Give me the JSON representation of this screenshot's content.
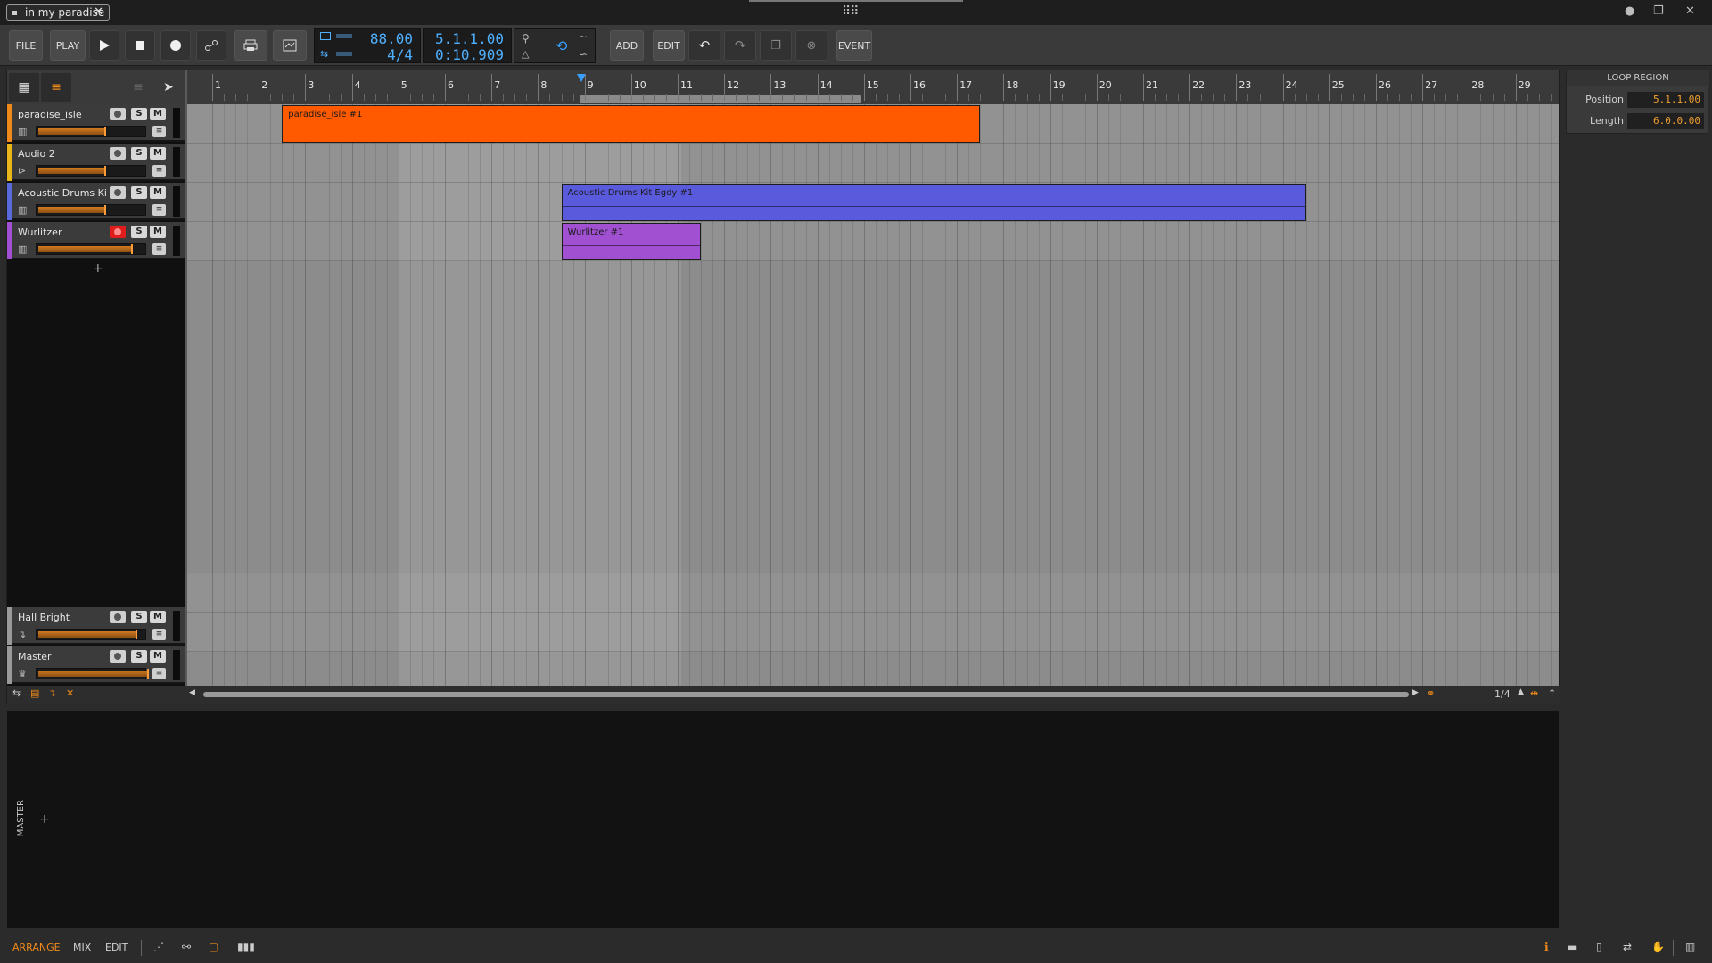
{
  "document": {
    "tab_title": "in my paradise"
  },
  "toolbar": {
    "file_label": "FILE",
    "play_label": "PLAY",
    "add_label": "ADD",
    "edit_label": "EDIT",
    "event_label": "EVENT",
    "tempo": "88.00",
    "time_signature": "4/4",
    "position_beats": "5.1.1.00",
    "position_time": "0:10.909"
  },
  "ruler": {
    "bars": [
      "1",
      "2",
      "3",
      "4",
      "5",
      "6",
      "7",
      "8",
      "9",
      "10",
      "11",
      "12",
      "13",
      "14",
      "15",
      "16",
      "17",
      "18",
      "19",
      "20",
      "21",
      "22",
      "23",
      "24",
      "25",
      "26",
      "27",
      "28",
      "29"
    ]
  },
  "tracks": [
    {
      "name": "paradise_isle",
      "color": "#f08a1a",
      "type_icon": "instrument-icon",
      "volume": 0.6,
      "armed": false
    },
    {
      "name": "Audio 2",
      "color": "#e8b81a",
      "type_icon": "audio-icon",
      "volume": 0.6,
      "armed": false
    },
    {
      "name": "Acoustic Drums Ki...",
      "color": "#5a6adc",
      "type_icon": "instrument-icon",
      "volume": 0.6,
      "armed": false
    },
    {
      "name": "Wurlitzer",
      "color": "#a050d0",
      "type_icon": "instrument-icon",
      "volume": 0.84,
      "armed": true
    }
  ],
  "fx_tracks": [
    {
      "name": "Hall Bright",
      "color": "#9a9a9a",
      "volume": 0.88
    },
    {
      "name": "Master",
      "color": "#9a9a9a",
      "volume": 0.98
    }
  ],
  "clips": [
    {
      "name": "paradise_isle #1",
      "track": 0,
      "start_bar": 2.5,
      "end_bar": 17.5,
      "color": "#ff5a00"
    },
    {
      "name": "Acoustic Drums Kit Egdy #1",
      "track": 2,
      "start_bar": 8.5,
      "end_bar": 24.5,
      "color": "#5a5adc"
    },
    {
      "name": "Wurlitzer #1",
      "track": 3,
      "start_bar": 8.5,
      "end_bar": 11.5,
      "color": "#a050d0"
    }
  ],
  "loop_region": {
    "header": "LOOP REGION",
    "position_label": "Position",
    "position_value": "5.1.1.00",
    "length_label": "Length",
    "length_value": "6.0.0.00"
  },
  "arrange_footer": {
    "grid": "1/4"
  },
  "bottom_panel": {
    "label": "MASTER"
  },
  "statusbar": {
    "arrange": "ARRANGE",
    "mix": "MIX",
    "edit": "EDIT"
  }
}
